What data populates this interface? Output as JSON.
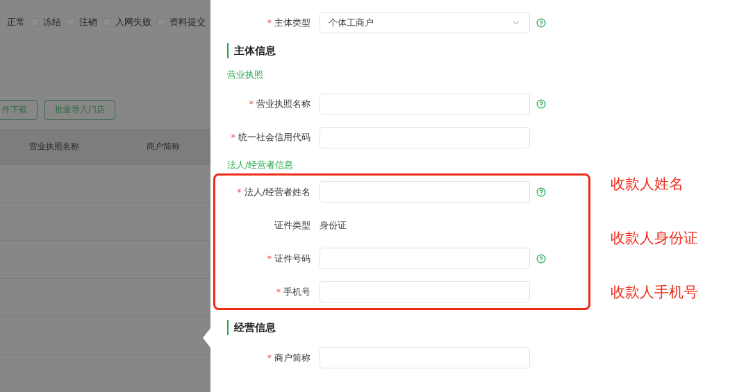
{
  "background": {
    "filters": [
      {
        "kind": "text",
        "label": "正常"
      },
      {
        "kind": "checkbox",
        "label": "冻结",
        "checked": false
      },
      {
        "kind": "checkbox",
        "label": "注销",
        "checked": false
      },
      {
        "kind": "checkbox",
        "label": "入网失败",
        "checked": false
      },
      {
        "kind": "checkbox",
        "label": "资料提交",
        "checked": false
      }
    ],
    "buttons": [
      "件下载",
      "批量导入门店"
    ],
    "table": {
      "columns": [
        "营业执照名称",
        "商户简称"
      ]
    }
  },
  "required_mark": "*",
  "form": [
    {
      "kind": "select",
      "label": "主体类型",
      "required": true,
      "value": "个体工商户",
      "help": true
    },
    {
      "kind": "heading",
      "text": "主体信息"
    },
    {
      "kind": "subheading",
      "text": "营业执照"
    },
    {
      "kind": "input",
      "label": "营业执照名称",
      "required": true,
      "help": true
    },
    {
      "kind": "input",
      "label": "统一社会信用代码",
      "required": true,
      "help": false
    },
    {
      "kind": "subheading",
      "text": "法人/经营者信息"
    },
    {
      "kind": "group",
      "fields": [
        {
          "kind": "input",
          "label": "法人/经营者姓名",
          "required": true,
          "help": true
        },
        {
          "kind": "text",
          "label": "证件类型",
          "required": false,
          "value": "身份证"
        },
        {
          "kind": "input",
          "label": "证件号码",
          "required": true,
          "help": true
        },
        {
          "kind": "input",
          "label": "手机号",
          "required": true,
          "help": false
        }
      ],
      "annotations": [
        "收款人姓名",
        "收款人身份证",
        "收款人手机号"
      ]
    },
    {
      "kind": "heading",
      "text": "经营信息"
    },
    {
      "kind": "input",
      "label": "商户简称",
      "required": true,
      "help": false
    }
  ]
}
